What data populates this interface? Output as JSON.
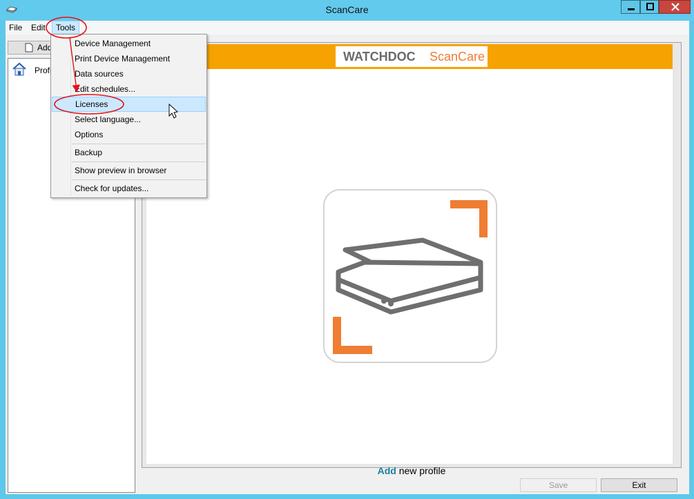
{
  "window": {
    "title": "ScanCare"
  },
  "menubar": {
    "file": "File",
    "edit": "Edit",
    "tools": "Tools"
  },
  "toolbar": {
    "add_label": "Add"
  },
  "left_panel": {
    "profile_label": "Profiles"
  },
  "tools_menu": {
    "items": [
      "Device Management",
      "Print Device Management",
      "Data sources",
      "Edit schedules...",
      "Licenses",
      "Select language...",
      "Options",
      "Backup",
      "Show preview in browser",
      "Check for updates..."
    ],
    "highlighted_index": 4
  },
  "banner": {
    "brand_left": "WATCHDOC",
    "brand_right": "ScanCare"
  },
  "main": {
    "add_link": "Add",
    "add_text": " new profile"
  },
  "footer": {
    "save_label": "Save",
    "exit_label": "Exit"
  },
  "colors": {
    "titlebar": "#62caec",
    "banner": "#f6a200",
    "accent_orange": "#ef7d32",
    "close_red": "#c7463e",
    "annotation_red": "#e0141e",
    "link": "#1a7fa0"
  }
}
